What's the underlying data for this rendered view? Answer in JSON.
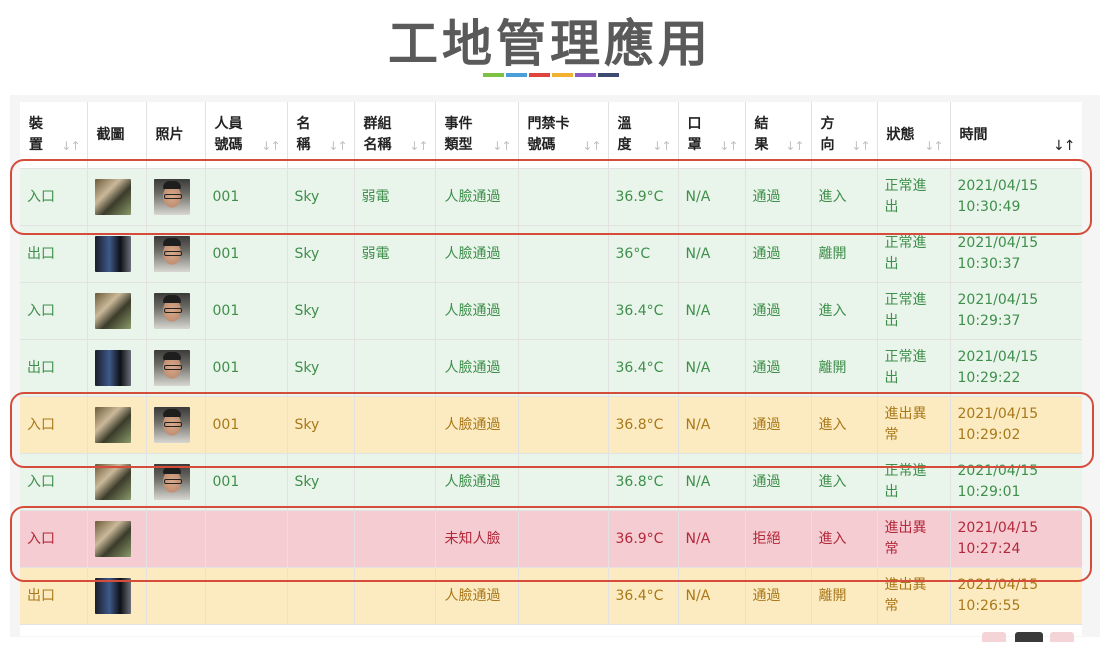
{
  "page_title": "工地管理應用",
  "accent_colors": [
    "#7dc142",
    "#4a9fd8",
    "#e0453d",
    "#f2b230",
    "#8a5cc4",
    "#3d4a72"
  ],
  "table": {
    "headers": [
      {
        "line1": "裝",
        "line2": "置",
        "sort": "↓↑"
      },
      {
        "line1": "截圖",
        "line2": "",
        "sort": ""
      },
      {
        "line1": "照片",
        "line2": "",
        "sort": ""
      },
      {
        "line1": "人員",
        "line2": "號碼",
        "sort": "↓↑"
      },
      {
        "line1": "名",
        "line2": "稱",
        "sort": "↓↑"
      },
      {
        "line1": "群組",
        "line2": "名稱",
        "sort": "↓↑"
      },
      {
        "line1": "事件",
        "line2": "類型",
        "sort": "↓↑"
      },
      {
        "line1": "門禁卡",
        "line2": "號碼",
        "sort": "↓↑"
      },
      {
        "line1": "溫",
        "line2": "度",
        "sort": "↓↑"
      },
      {
        "line1": "口",
        "line2": "罩",
        "sort": "↓↑"
      },
      {
        "line1": "結",
        "line2": "果",
        "sort": "↓↑"
      },
      {
        "line1": "方",
        "line2": "向",
        "sort": "↓↑"
      },
      {
        "line1": "狀態",
        "line2": "",
        "sort": "↓↑"
      },
      {
        "line1": "時間",
        "line2": "",
        "sort": "↓↑"
      }
    ],
    "rows": [
      {
        "status_color": "green",
        "device": "入口",
        "snapshot": "snapshot-image",
        "photo": "face-photo",
        "person_id": "001",
        "name": "Sky",
        "group": "弱電",
        "event": "人臉通過",
        "card": "",
        "temp": "36.9°C",
        "mask": "N/A",
        "result": "通過",
        "direction": "進入",
        "state": "正常進出",
        "date": "2021/04/15",
        "time": "10:30:49"
      },
      {
        "status_color": "green",
        "device": "出口",
        "snapshot": "snapshot-image",
        "photo": "face-photo",
        "person_id": "001",
        "name": "Sky",
        "group": "弱電",
        "event": "人臉通過",
        "card": "",
        "temp": "36°C",
        "mask": "N/A",
        "result": "通過",
        "direction": "離開",
        "state": "正常進出",
        "date": "2021/04/15",
        "time": "10:30:37"
      },
      {
        "status_color": "green",
        "device": "入口",
        "snapshot": "snapshot-image",
        "photo": "face-photo",
        "person_id": "001",
        "name": "Sky",
        "group": "",
        "event": "人臉通過",
        "card": "",
        "temp": "36.4°C",
        "mask": "N/A",
        "result": "通過",
        "direction": "進入",
        "state": "正常進出",
        "date": "2021/04/15",
        "time": "10:29:37"
      },
      {
        "status_color": "green",
        "device": "出口",
        "snapshot": "snapshot-image",
        "photo": "face-photo",
        "person_id": "001",
        "name": "Sky",
        "group": "",
        "event": "人臉通過",
        "card": "",
        "temp": "36.4°C",
        "mask": "N/A",
        "result": "通過",
        "direction": "離開",
        "state": "正常進出",
        "date": "2021/04/15",
        "time": "10:29:22"
      },
      {
        "status_color": "yellow",
        "device": "入口",
        "snapshot": "snapshot-image",
        "photo": "face-photo",
        "person_id": "001",
        "name": "Sky",
        "group": "",
        "event": "人臉通過",
        "card": "",
        "temp": "36.8°C",
        "mask": "N/A",
        "result": "通過",
        "direction": "進入",
        "state": "進出異常",
        "date": "2021/04/15",
        "time": "10:29:02"
      },
      {
        "status_color": "green",
        "device": "入口",
        "snapshot": "snapshot-image",
        "photo": "face-photo",
        "person_id": "001",
        "name": "Sky",
        "group": "",
        "event": "人臉通過",
        "card": "",
        "temp": "36.8°C",
        "mask": "N/A",
        "result": "通過",
        "direction": "進入",
        "state": "正常進出",
        "date": "2021/04/15",
        "time": "10:29:01"
      },
      {
        "status_color": "red",
        "device": "入口",
        "snapshot": "snapshot-image",
        "photo": "",
        "person_id": "",
        "name": "",
        "group": "",
        "event": "未知人臉",
        "card": "",
        "temp": "36.9°C",
        "mask": "N/A",
        "result": "拒絕",
        "direction": "進入",
        "state": "進出異常",
        "date": "2021/04/15",
        "time": "10:27:24"
      },
      {
        "status_color": "yellow",
        "device": "出口",
        "snapshot": "snapshot-image",
        "photo": "",
        "person_id": "",
        "name": "",
        "group": "",
        "event": "人臉通過",
        "card": "",
        "temp": "36.4°C",
        "mask": "N/A",
        "result": "通過",
        "direction": "離開",
        "state": "進出異常",
        "date": "2021/04/15",
        "time": "10:26:55"
      }
    ]
  },
  "highlight_color": "#d64c3a"
}
